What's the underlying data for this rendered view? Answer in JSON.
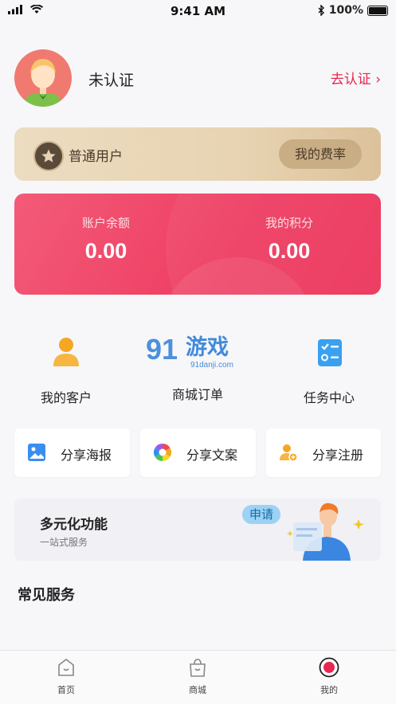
{
  "status_bar": {
    "time": "9:41 AM",
    "battery": "100%"
  },
  "profile": {
    "name": "未认证",
    "verify_link": "去认证"
  },
  "member_card": {
    "level": "普通用户",
    "rate_button": "我的费率"
  },
  "balance_card": {
    "balance_label": "账户余额",
    "balance_value": "0.00",
    "points_label": "我的积分",
    "points_value": "0.00"
  },
  "quick_actions": [
    {
      "label": "我的客户",
      "icon": "customer-icon"
    },
    {
      "label": "商城订单",
      "icon": "order-icon"
    },
    {
      "label": "任务中心",
      "icon": "task-icon"
    }
  ],
  "share_actions": [
    {
      "label": "分享海报",
      "icon": "poster-icon"
    },
    {
      "label": "分享文案",
      "icon": "copywriting-icon"
    },
    {
      "label": "分享注册",
      "icon": "register-icon"
    }
  ],
  "feature_banner": {
    "title": "多元化功能",
    "subtitle": "一站式服务",
    "badge": "申请"
  },
  "section": {
    "title": "常见服务"
  },
  "watermark": {
    "brand": "游戏",
    "url": "91danji.com",
    "number": "91"
  },
  "tabbar": [
    {
      "label": "首页",
      "icon": "home-icon"
    },
    {
      "label": "商城",
      "icon": "shop-bag-icon"
    },
    {
      "label": "我的",
      "icon": "profile-icon",
      "active": true
    }
  ],
  "colors": {
    "accent": "#e8264f",
    "gold_card": "#e8d4b3",
    "balance_card": "#ee3d62"
  }
}
